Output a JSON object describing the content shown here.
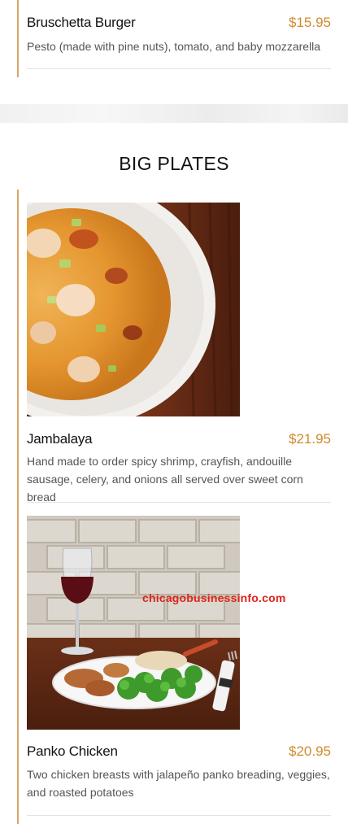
{
  "top_item": {
    "name": "Bruschetta Burger",
    "price": "$15.95",
    "description": "Pesto (made with pine nuts), tomato, and baby mozzarella"
  },
  "section": {
    "title": "BIG PLATES"
  },
  "items": [
    {
      "name": "Jambalaya",
      "price": "$21.95",
      "description": "Hand made to order spicy shrimp, crayfish, andouille sausage, celery, and onions all served over sweet corn bread"
    },
    {
      "name": "Panko Chicken",
      "price": "$20.95",
      "description": "Two chicken breasts with jalapeño panko breading, veggies, and roasted potatoes"
    }
  ],
  "watermark": "chicagobusinessinfo.com",
  "colors": {
    "accent": "#cf8b2b",
    "rule": "#d9a46b",
    "watermark": "#e0241a"
  }
}
